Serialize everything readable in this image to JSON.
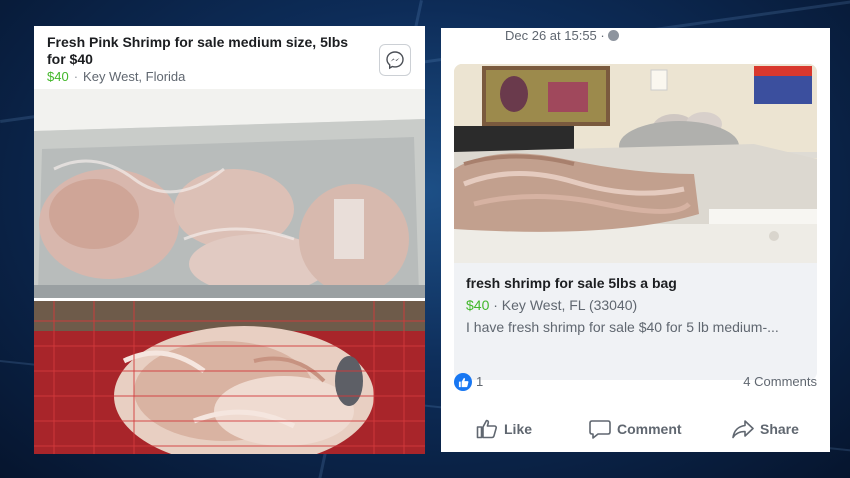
{
  "left_post": {
    "title": "Fresh Pink Shrimp for sale medium size, 5lbs for $40",
    "price": "$40",
    "separator": "·",
    "location": "Key West, Florida",
    "messenger_icon": "messenger-icon"
  },
  "right_post": {
    "date": "Dec 26 at 15:55 ·",
    "privacy_icon": "globe-icon",
    "listing": {
      "title": "fresh shrimp for sale 5lbs a bag",
      "price": "$40",
      "location": "· Key West, FL (33040)",
      "description": "I have fresh shrimp for sale $40 for 5 lb medium-..."
    },
    "reactions": {
      "like_count": "1",
      "comments": "4 Comments"
    },
    "actions": {
      "like": "Like",
      "comment": "Comment",
      "share": "Share"
    }
  },
  "colors": {
    "price_green": "#42b72a",
    "facebook_blue": "#1877f2",
    "text_gray": "#606770"
  }
}
